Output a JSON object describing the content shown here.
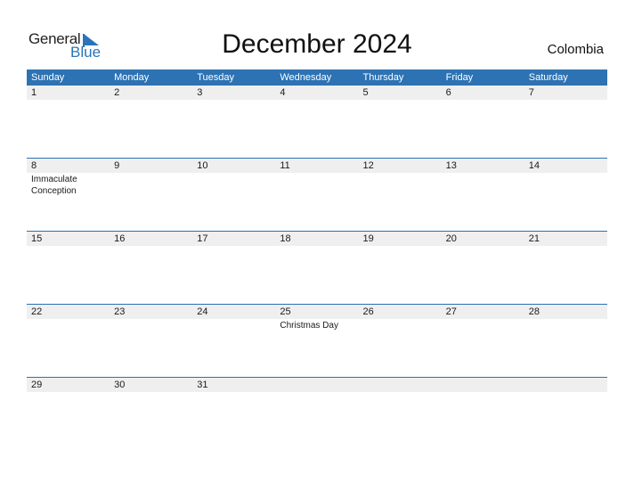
{
  "logo": {
    "line1": "General",
    "line2": "Blue"
  },
  "title": "December 2024",
  "country": "Colombia",
  "weekdays": [
    "Sunday",
    "Monday",
    "Tuesday",
    "Wednesday",
    "Thursday",
    "Friday",
    "Saturday"
  ],
  "weeks": [
    {
      "days": [
        "1",
        "2",
        "3",
        "4",
        "5",
        "6",
        "7"
      ],
      "events": [
        "",
        "",
        "",
        "",
        "",
        "",
        ""
      ]
    },
    {
      "days": [
        "8",
        "9",
        "10",
        "11",
        "12",
        "13",
        "14"
      ],
      "events": [
        "Immaculate Conception",
        "",
        "",
        "",
        "",
        "",
        ""
      ]
    },
    {
      "days": [
        "15",
        "16",
        "17",
        "18",
        "19",
        "20",
        "21"
      ],
      "events": [
        "",
        "",
        "",
        "",
        "",
        "",
        ""
      ]
    },
    {
      "days": [
        "22",
        "23",
        "24",
        "25",
        "26",
        "27",
        "28"
      ],
      "events": [
        "",
        "",
        "",
        "Christmas Day",
        "",
        "",
        ""
      ]
    },
    {
      "days": [
        "29",
        "30",
        "31",
        "",
        "",
        "",
        ""
      ],
      "events": [
        "",
        "",
        "",
        "",
        "",
        "",
        ""
      ]
    }
  ],
  "colors": {
    "accent": "#2d72b3",
    "date_row_bg": "#efefef"
  }
}
